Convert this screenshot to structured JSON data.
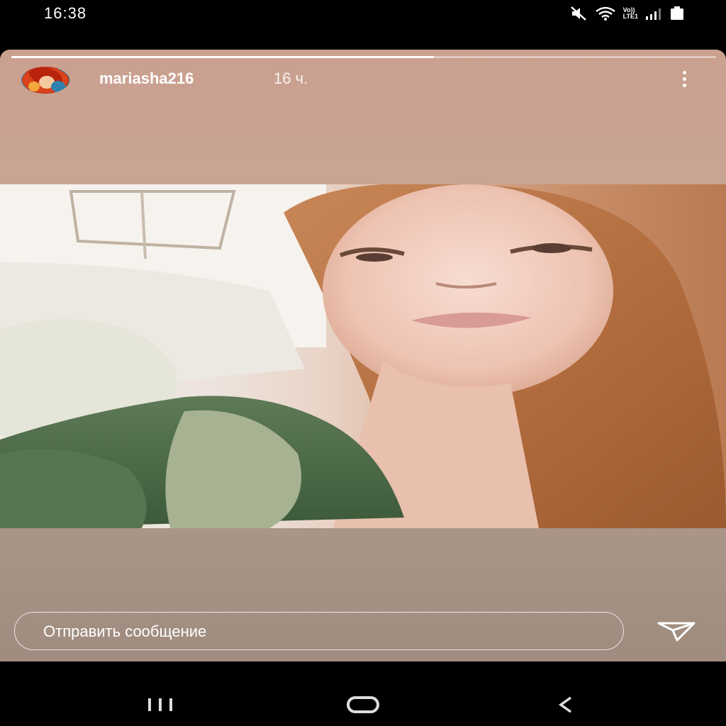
{
  "status_bar": {
    "time": "16:38",
    "icons": [
      "mute-icon",
      "wifi-icon",
      "volte-lte-icon",
      "signal-icon",
      "battery-icon"
    ],
    "volte_label": "Vo))",
    "lte_label": "LTE1"
  },
  "story": {
    "progress": 0.6,
    "username": "mariasha216",
    "time_ago": "16 ч.",
    "menu_icon": "more-vertical-icon"
  },
  "reply": {
    "placeholder": "Отправить сообщение",
    "send_icon": "send-icon"
  },
  "nav_bar": {
    "icons": [
      "recent-apps-icon",
      "home-icon",
      "back-icon"
    ]
  },
  "colors": {
    "background": "#000000",
    "story_gradient_top": "#caa08f",
    "story_gradient_bottom": "#9f8c7f",
    "text": "#ffffff"
  }
}
